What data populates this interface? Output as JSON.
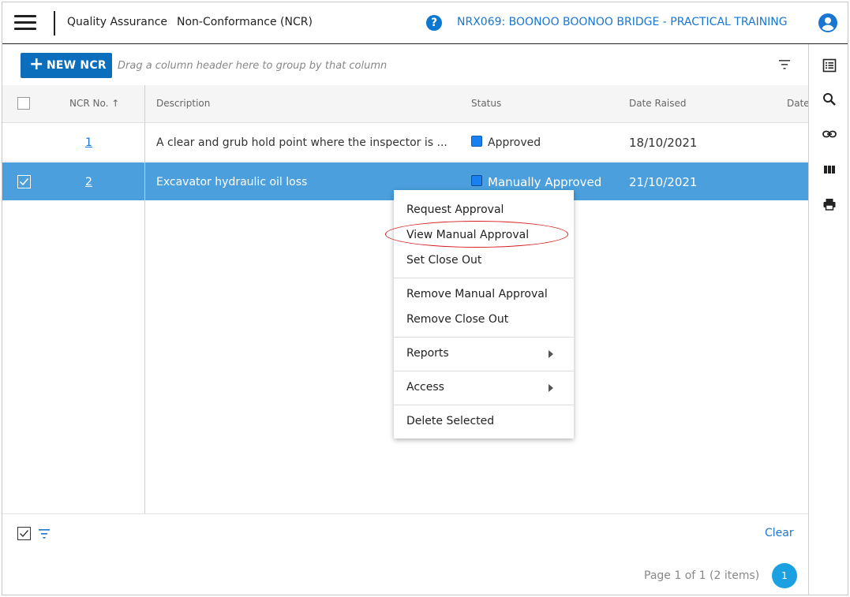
{
  "header": {
    "crumb_module": "Quality Assurance",
    "crumb_page": "Non-Conformance (NCR)",
    "help_glyph": "?",
    "project": "NRX069: BOONOO BOONOO BRIDGE - PRACTICAL TRAINING"
  },
  "toolbar": {
    "new_button": "NEW NCR",
    "drag_hint": "Drag a column header here to group by that column"
  },
  "columns": {
    "ncr_no": "NCR No. ↑",
    "description": "Description",
    "status": "Status",
    "date_raised": "Date Raised",
    "date_cut": "Date"
  },
  "rows": [
    {
      "ncr_no": "1",
      "description": "A clear and grub hold point where the inspector is ...",
      "status": "Approved",
      "date_raised": "18/10/2021",
      "selected": false
    },
    {
      "ncr_no": "2",
      "description": "Excavator hydraulic oil loss",
      "status": "Manually Approved",
      "date_raised": "21/10/2021",
      "selected": true
    }
  ],
  "context_menu": {
    "items": [
      "Request Approval",
      "View Manual Approval",
      "Set Close Out",
      "Remove Manual Approval",
      "Remove Close Out",
      "Reports",
      "Access",
      "Delete Selected"
    ],
    "highlighted": "View Manual Approval"
  },
  "footer": {
    "clear_label": "Clear",
    "page_info": "Page 1 of 1 (2 items)",
    "current_page": "1"
  },
  "right_toolbar": [
    "list-view-icon",
    "search-icon",
    "link-icon",
    "columns-icon",
    "print-icon"
  ],
  "colors": {
    "accent": "#1976d2",
    "selected_row": "#4a9fdc",
    "status_square": "#1a7ff0",
    "highlight_ellipse": "#d41e1e",
    "new_button": "#0a6ebd"
  }
}
